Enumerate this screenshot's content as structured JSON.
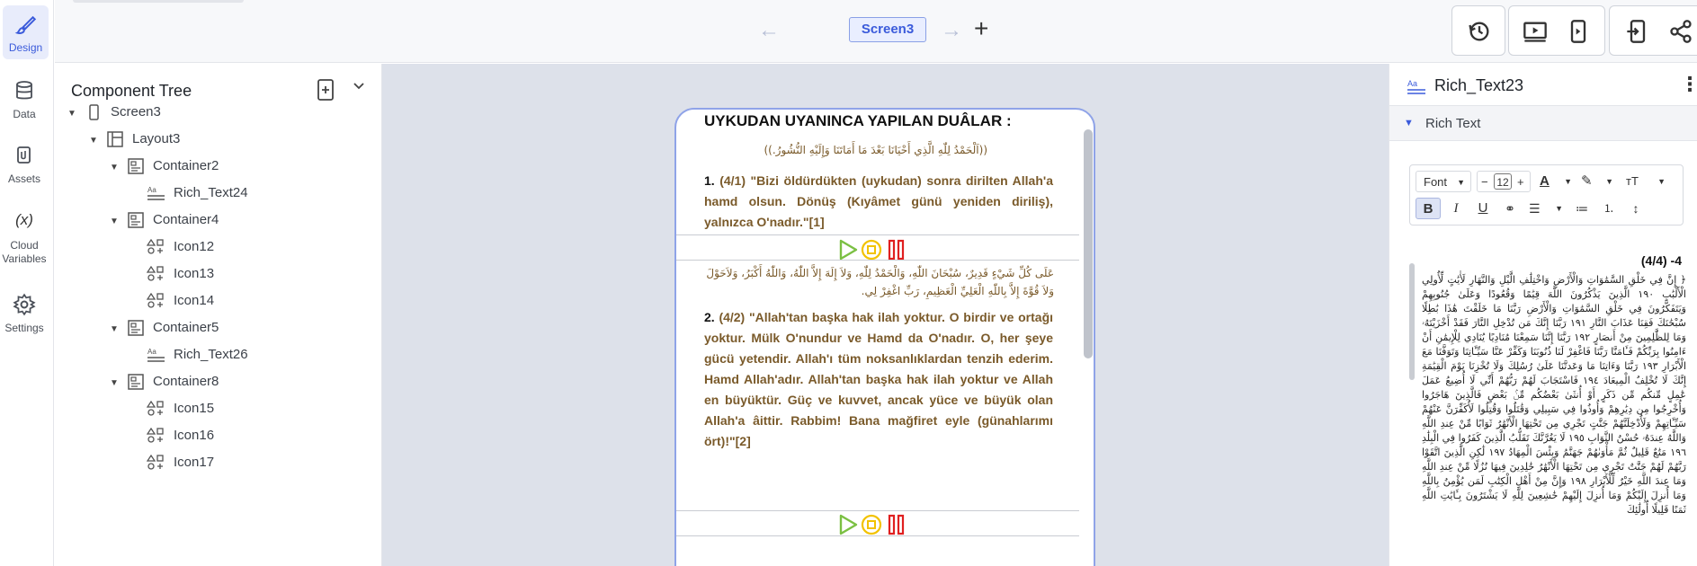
{
  "rail": {
    "items": [
      {
        "label": "Design",
        "icon": "brush-icon",
        "active": true
      },
      {
        "label": "Data",
        "icon": "database-icon"
      },
      {
        "label": "Assets",
        "icon": "assets-icon"
      },
      {
        "label": "Cloud Variables",
        "icon": "variable-icon",
        "glyph": "(x)"
      },
      {
        "label": "Settings",
        "icon": "gear-icon"
      }
    ]
  },
  "topbar": {
    "screen_name": "Screen3",
    "back_glyph": "←",
    "forward_glyph": "→",
    "add_glyph": "+"
  },
  "tree": {
    "title": "Component Tree",
    "rows": [
      {
        "label": "Screen3",
        "indent": 0,
        "icon": "phone-icon",
        "caret": "▼"
      },
      {
        "label": "Layout3",
        "indent": 1,
        "icon": "layout-icon",
        "caret": "▼"
      },
      {
        "label": "Container2",
        "indent": 2,
        "icon": "container-icon",
        "caret": "▼"
      },
      {
        "label": "Rich_Text24",
        "indent": 3,
        "icon": "richtext-icon",
        "caret": ""
      },
      {
        "label": "Container4",
        "indent": 2,
        "icon": "container-icon",
        "caret": "▼"
      },
      {
        "label": "Icon12",
        "indent": 3,
        "icon": "shapes-icon",
        "caret": ""
      },
      {
        "label": "Icon13",
        "indent": 3,
        "icon": "shapes-icon",
        "caret": ""
      },
      {
        "label": "Icon14",
        "indent": 3,
        "icon": "shapes-icon",
        "caret": ""
      },
      {
        "label": "Container5",
        "indent": 2,
        "icon": "container-icon",
        "caret": "▼"
      },
      {
        "label": "Rich_Text26",
        "indent": 3,
        "icon": "richtext-icon",
        "caret": ""
      },
      {
        "label": "Container8",
        "indent": 2,
        "icon": "container-icon",
        "caret": "▼"
      },
      {
        "label": "Icon15",
        "indent": 3,
        "icon": "shapes-icon",
        "caret": ""
      },
      {
        "label": "Icon16",
        "indent": 3,
        "icon": "shapes-icon",
        "caret": ""
      },
      {
        "label": "Icon17",
        "indent": 3,
        "icon": "shapes-icon",
        "caret": ""
      }
    ]
  },
  "phone": {
    "title": "UYKUDAN UYANINCA YAPILAN DUÂLAR :",
    "dua1_arabic": "((اَلْحَمْدُ لِلّٰهِ الَّذِي أَحْيَانَا بَعْدَ مَا أَمَاتَنَا وَإِلَيْهِ النُّشُورُ.))",
    "dua1_num": "1.",
    "dua1_text": "(4/1) \"Bizi öldürdükten (uykudan) sonra dirilten Allah'a hamd olsun. Dönüş (Kıyâmet günü yeniden diriliş), yalnızca O'nadır.\"[1]",
    "dua2_arabic": "عَلَى كُلِّ شَيْءٍ قَدِيرٌ، سُبْحَانَ اللّٰهِ، وَالْحَمْدُ لِلّٰهِ، وَلاَ إِلَهَ إِلاَّ اللّٰهُ، وَاللّٰهُ أَكْبَرُ، وَلاَحَوْلَ وَلاَ قُوَّةَ إِلاَّ بِاللّٰهِ الْعَلِيِّ الْعَظِيمِ، رَبِّ اغْفِرْ لِي.",
    "dua2_num": "2.",
    "dua2_text": "(4/2) \"Allah'tan başka hak ilah yoktur. O birdir ve ortağı yoktur. Mülk O'nundur ve Hamd da O'nadır. O, her şeye gücü yetendir. Allah'ı tüm noksanlıklardan tenzih ederim. Hamd Allah'adır. Allah'tan başka hak ilah yoktur ve Allah en büyüktür. Güç ve kuvvet, ancak yüce ve büyük olan Allah'a âittir. Rabbim! Bana mağfiret eyle (günahlarımı ört)!\"[2]",
    "colors": {
      "play": "#7bc043",
      "stop": "#f2c200",
      "pause": "#e02020",
      "text": "#7a5a2a"
    }
  },
  "props": {
    "component_name": "Rich_Text23",
    "section": "Rich Text",
    "font_label": "Font",
    "font_size": "12",
    "minus": "−",
    "plus": "+",
    "editor_heading": "(4/4) -4",
    "editor_body": "﴿ إِنَّ فِي خَلْقِ السَّمَٰوَاتِ وَالْأَرْضِ وَاخْتِلَٰفِ الَّيْلِ وَالنَّهَارِ لَأٰيَٰتٍ لِّأُولِي الْأَلْبَٰبِ ١٩٠ الَّذِينَ يَذْكُرُونَ اللَّهَ قِيَٰمًا وَقُعُودًا وَعَلَىٰ جُنُوبِهِمْ وَيَتَفَكَّرُونَ فِي خَلْقِ السَّمَٰوَاتِ وَالْأَرْضِ رَبَّنَا مَا خَلَقْتَ هَٰذَا بَٰطِلًا سُبْحَٰنَكَ فَقِنَا عَذَابَ النَّارِ ١٩١ رَبَّنَا إِنَّكَ مَن تُدْخِلِ النَّارَ فَقَدْ أَخْزَيْتَهُۥ وَمَا لِلظَّٰلِمِينَ مِنْ أَنصَارٍ ١٩٢ رَبَّنَا إِنَّنَا سَمِعْنَا مُنَادِيًا يُنَادِي لِلْإِيمَٰنِ أَنْ ءَامِنُوا بِرَبِّكُمْ فَـَٔامَنَّا رَبَّنَا فَاغْفِرْ لَنَا ذُنُوبَنَا وَكَفِّرْ عَنَّا سَيِّـَٔاتِنَا وَتَوَفَّنَا مَعَ الْأَبْرَارِ ١٩٣ رَبَّنَا وَءَاتِنَا مَا وَعَدتَّنَا عَلَىٰ رُسُلِكَ وَلَا تُخْزِنَا يَوْمَ الْقِيَٰمَةِ إِنَّكَ لَا تُخْلِفُ الْمِيعَادَ ١٩٤ فَاسْتَجَابَ لَهُمْ رَبُّهُمْ أَنِّي لَا أُضِيعُ عَمَلَ عَٰمِلٍ مِّنكُم مِّن ذَكَرٍ أَوْ أُنثَىٰ بَعْضُكُم مِّنۢ بَعْضٍ فَالَّذِينَ هَاجَرُوا وَأُخْرِجُوا مِن دِيَٰرِهِمْ وَأُوذُوا فِي سَبِيلِي وَقَٰتَلُوا وَقُتِلُوا لَأُكَفِّرَنَّ عَنْهُمْ سَيِّـَٔاتِهِمْ وَلَأُدْخِلَنَّهُمْ جَنَّٰتٍ تَجْرِي مِن تَحْتِهَا الْأَنْهَٰرُ ثَوَابًا مِّنْ عِندِ اللَّهِ وَاللَّهُ عِندَهُۥ حُسْنُ الثَّوَابِ ١٩٥ لَا يَغُرَّنَّكَ تَقَلُّبُ الَّذِينَ كَفَرُوا فِي الْبِلَٰدِ ١٩٦ مَتَٰعٌ قَلِيلٌ ثُمَّ مَأْوَىٰهُمْ جَهَنَّمُ وَبِئْسَ الْمِهَادُ ١٩٧ لَٰكِنِ الَّذِينَ اتَّقَوْا رَبَّهُمْ لَهُمْ جَنَّٰتٌ تَجْرِي مِن تَحْتِهَا الْأَنْهَٰرُ خَٰلِدِينَ فِيهَا نُزُلًا مِّنْ عِندِ اللَّهِ وَمَا عِندَ اللَّهِ خَيْرٌ لِّلْأَبْرَارِ ١٩٨ وَإِنَّ مِنْ أَهْلِ الْكِتَٰبِ لَمَن يُؤْمِنُ بِاللَّهِ وَمَا أُنزِلَ إِلَيْكُمْ وَمَا أُنزِلَ إِلَيْهِمْ خَٰشِعِينَ لِلَّهِ لَا يَشْتَرُونَ بِـَٔايَٰتِ اللَّهِ ثَمَنًا قَلِيلًا أُولَٰئِكَ"
  },
  "accent": "#3b5bdb"
}
